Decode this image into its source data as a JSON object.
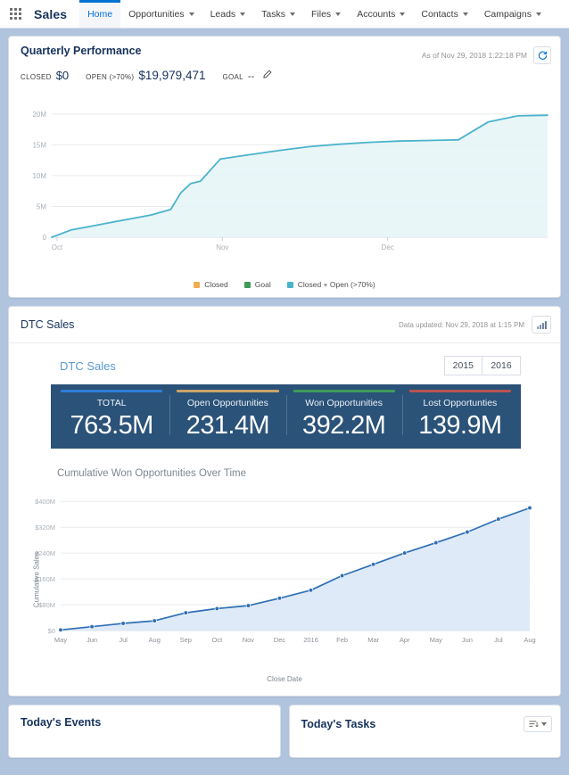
{
  "nav": {
    "app_name": "Sales",
    "app_launcher_icon": "waffle-grid-icon",
    "items": [
      {
        "label": "Home",
        "has_menu": false,
        "active": true
      },
      {
        "label": "Opportunities",
        "has_menu": true,
        "active": false
      },
      {
        "label": "Leads",
        "has_menu": true,
        "active": false
      },
      {
        "label": "Tasks",
        "has_menu": true,
        "active": false
      },
      {
        "label": "Files",
        "has_menu": true,
        "active": false
      },
      {
        "label": "Accounts",
        "has_menu": true,
        "active": false
      },
      {
        "label": "Contacts",
        "has_menu": true,
        "active": false
      },
      {
        "label": "Campaigns",
        "has_menu": true,
        "active": false
      }
    ]
  },
  "quarterly_performance": {
    "title": "Quarterly Performance",
    "as_of": "As of Nov 29, 2018 1:22:18 PM",
    "refresh_icon": "refresh-icon",
    "edit_icon": "pencil-icon",
    "metrics": [
      {
        "label": "CLOSED",
        "value": "$0"
      },
      {
        "label": "OPEN (>70%)",
        "value": "$19,979,471"
      },
      {
        "label": "GOAL",
        "value": "--"
      }
    ]
  },
  "dtc_sales": {
    "card_title": "DTC Sales",
    "data_updated": "Data updated: Nov 29, 2018 at 1:15 PM",
    "chart_icon": "bar-chart-icon",
    "dashboard_title": "DTC Sales",
    "year_buttons": [
      {
        "label": "2015",
        "selected": false
      },
      {
        "label": "2016",
        "selected": false
      }
    ],
    "kpis": [
      {
        "label": "TOTAL",
        "value": "763.5M",
        "color": "#2f7ed8"
      },
      {
        "label": "Open Opportunities",
        "value": "231.4M",
        "color": "#c9a36a"
      },
      {
        "label": "Won Opportunities",
        "value": "392.2M",
        "color": "#3f9c5b"
      },
      {
        "label": "Lost Opportunties",
        "value": "139.9M",
        "color": "#b85450"
      }
    ],
    "panel_bg": "#2b5278"
  },
  "bottom": {
    "events": {
      "title": "Today's Events"
    },
    "tasks": {
      "title": "Today's Tasks",
      "sort_icon": "sort-icon",
      "chevron_icon": "chevron-down-icon"
    }
  },
  "chart_data": [
    {
      "id": "quarterly",
      "type": "area",
      "title": "Quarterly Performance",
      "xlabel": "",
      "ylabel": "",
      "ylim": [
        0,
        22000000
      ],
      "yticks": [
        0,
        5000000,
        10000000,
        15000000,
        20000000
      ],
      "ytick_labels": [
        "0",
        "5M",
        "10M",
        "15M",
        "20M"
      ],
      "xticks": [
        "Oct",
        "Nov",
        "Dec"
      ],
      "grid": true,
      "legend_position": "bottom",
      "legend": [
        {
          "name": "Closed",
          "color": "#f0ad4e"
        },
        {
          "name": "Goal",
          "color": "#3f9c5b"
        },
        {
          "name": "Closed + Open (>70%)",
          "color": "#4bb3cc"
        }
      ],
      "series": [
        {
          "name": "Closed + Open (>70%)",
          "color": "#4bb3cc",
          "fill": "#e4f4f7",
          "x": [
            0,
            4,
            8,
            12,
            16,
            20,
            24,
            26,
            28,
            30,
            34,
            40,
            46,
            52,
            58,
            64,
            70,
            76,
            82,
            88,
            94,
            100
          ],
          "values": [
            0,
            1200000,
            1800000,
            2400000,
            3000000,
            3600000,
            4500000,
            7200000,
            8700000,
            9100000,
            12700000,
            13400000,
            14100000,
            14700000,
            15100000,
            15400000,
            15600000,
            15700000,
            15800000,
            18700000,
            19700000,
            19800000
          ]
        }
      ]
    },
    {
      "id": "cumulative_won",
      "type": "line",
      "title": "Cumulative Won Opportunities Over Time",
      "xlabel": "Close Date",
      "ylabel": "Cumulative Sales",
      "ylim": [
        0,
        420000000
      ],
      "yticks": [
        0,
        80000000,
        160000000,
        240000000,
        320000000,
        400000000
      ],
      "ytick_labels": [
        "$0",
        "$80M",
        "$160M",
        "$240M",
        "$320M",
        "$400M"
      ],
      "grid": true,
      "line_color": "#2f6fb5",
      "fill_color": "#dbe8f7",
      "marker": true,
      "categories": [
        "May",
        "Jun",
        "Jul",
        "Aug",
        "Sep",
        "Oct",
        "Nov",
        "Dec",
        "2016",
        "Feb",
        "Mar",
        "Apr",
        "May",
        "Jun",
        "Jul",
        "Aug"
      ],
      "values": [
        2000000,
        12000000,
        22000000,
        30000000,
        55000000,
        68000000,
        77000000,
        100000000,
        125000000,
        170000000,
        205000000,
        240000000,
        272000000,
        305000000,
        345000000,
        380000000
      ]
    }
  ]
}
